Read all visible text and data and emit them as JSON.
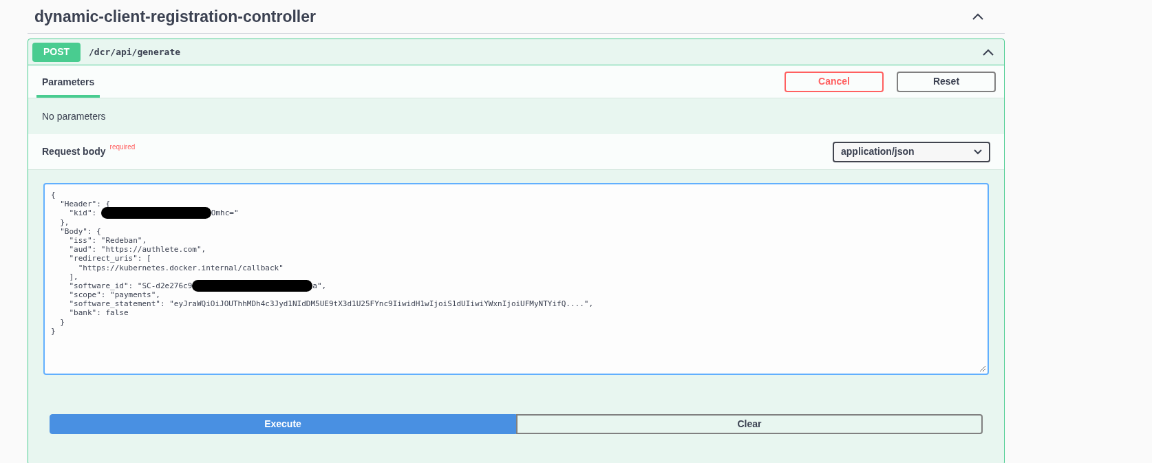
{
  "section": {
    "title": "dynamic-client-registration-controller",
    "expanded": true
  },
  "operation": {
    "method": "POST",
    "path": "/dcr/api/generate",
    "expanded": true
  },
  "tabs": [
    {
      "label": "Parameters",
      "selected": true
    }
  ],
  "actions": [
    {
      "label": "Cancel",
      "kind": "cancel"
    },
    {
      "label": "Reset",
      "kind": "reset"
    }
  ],
  "parameters_note": "No parameters",
  "request_body": {
    "label": "Request body",
    "required_label": "required",
    "content_type": "application/json"
  },
  "editor_lines": [
    {
      "parts": [
        "{"
      ]
    },
    {
      "parts": [
        "  \"Header\": {"
      ]
    },
    {
      "parts": [
        "    \"kid\": "
      ],
      "redacted": true,
      "after": "Omhc=\""
    },
    {
      "parts": [
        "  },"
      ]
    },
    {
      "parts": [
        "  \"Body\": {"
      ]
    },
    {
      "parts": [
        "    \"iss\": \"Redeban\","
      ]
    },
    {
      "parts": [
        "    \"aud\": \"https://authlete.com\","
      ]
    },
    {
      "parts": [
        "    \"redirect_uris\": ["
      ]
    },
    {
      "parts": [
        "      \"https://kubernetes.docker.internal/callback\""
      ]
    },
    {
      "parts": [
        "    ],"
      ]
    },
    {
      "parts": [
        "    \"software_id\": \"SC-d2e276c9"
      ],
      "redacted": true,
      "after": "a\","
    },
    {
      "parts": [
        "    \"scope\": \"payments\","
      ]
    },
    {
      "parts": [
        "    \"software_statement\": \"eyJraWQiOiJOUThhMDh4c3Jyd1NIdDM5UE9tX3d1U25FYnc9IiwidH1wIjoiS1dUIiwiYWxnIjoiUFMyNTYifQ....\","
      ]
    },
    {
      "parts": [
        "    \"bank\": false"
      ]
    },
    {
      "parts": [
        "  }"
      ]
    },
    {
      "parts": [
        "}"
      ]
    }
  ],
  "buttons": [
    {
      "label": "Execute",
      "kind": "primary"
    },
    {
      "label": "Clear",
      "kind": "secondary"
    }
  ]
}
